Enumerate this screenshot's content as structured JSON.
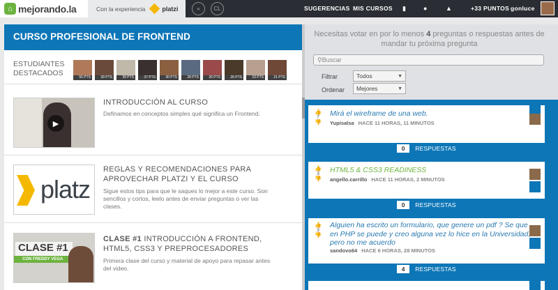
{
  "topbar": {
    "logo_text": "mejorando",
    "logo_tld": ".la",
    "experience_label": "Con la experiencia",
    "partner": "platzi",
    "nav": [
      "SUGERENCIAS",
      "MIS CURSOS"
    ],
    "points": "+33 PUNTOS",
    "username": "gonluce"
  },
  "course": {
    "title": "CURSO PROFESIONAL DE FRONTEND",
    "students_label": "ESTUDIANTES DESTACADOS",
    "students": [
      {
        "pts": "55 PTS"
      },
      {
        "pts": "39 PTS"
      },
      {
        "pts": "39 PTS"
      },
      {
        "pts": "37 PTS"
      },
      {
        "pts": "30 PTS"
      },
      {
        "pts": "28 PTS"
      },
      {
        "pts": "26 PTS"
      },
      {
        "pts": "26 PTS"
      },
      {
        "pts": "23 PTS"
      },
      {
        "pts": "21 PTS"
      }
    ],
    "lessons": [
      {
        "title": "INTRODUCCIÓN AL CURSO",
        "desc": "Definamos en conceptos simples qué significa un Frontend."
      },
      {
        "title": "REGLAS Y RECOMENDACIONES PARA APROVECHAR PLATZI Y EL CURSO",
        "desc": "Sigue estos tips para que le saques lo mejor a este curso. Son sencillos y cortos, leelo antes de enviar preguntas o ver las clases.",
        "thumb_text": "platz"
      },
      {
        "title_strong": "CLASE #1",
        "title": " INTRODUCCIÓN A FRONTEND, HTML5, CSS3 Y PREPROCESADORES",
        "desc": "Primera clase del curso y material de apoyo para repasar antes del video.",
        "thumb_badge": "CLASE #1",
        "thumb_sub": "CON FREDDY VEGA"
      }
    ]
  },
  "questions_panel": {
    "notice_pre": "Necesitas votar en por lo menos ",
    "notice_num": "4",
    "notice_post": " preguntas o respuestas antes de mandar tu próxima pregunta",
    "search_placeholder": "Buscar",
    "filter_label": "Filtrar",
    "filter_value": "Todos",
    "order_label": "Ordenar",
    "order_value": "Mejores",
    "answers_label": "RESPUESTAS",
    "questions": [
      {
        "text": "Mirá el wireframe de una web.",
        "votes": "7",
        "author": "Yupisalsa",
        "time": "HACE 11 HORAS, 11 MINUTOS",
        "answers": "0"
      },
      {
        "text": "HTML5 & CSS3 READINESS",
        "votes": "3",
        "author": "angello.carrillo",
        "time": "HACE 11 HORAS, 2 MINUTOS",
        "answers": "0"
      },
      {
        "text": "Alguien ha escrito un formulario, que genere un pdf ? Se que en PHP se puede y creo alguna vez lo hice en la Universidad, pero no me acuerdo",
        "votes": "3",
        "author": "sandovo64",
        "time": "HACE 6 HORAS, 28 MINUTOS",
        "answers": "4"
      }
    ]
  },
  "colors": {
    "accent": "#0d76b7",
    "green": "#6cb33f",
    "dark": "#2a2d33"
  }
}
